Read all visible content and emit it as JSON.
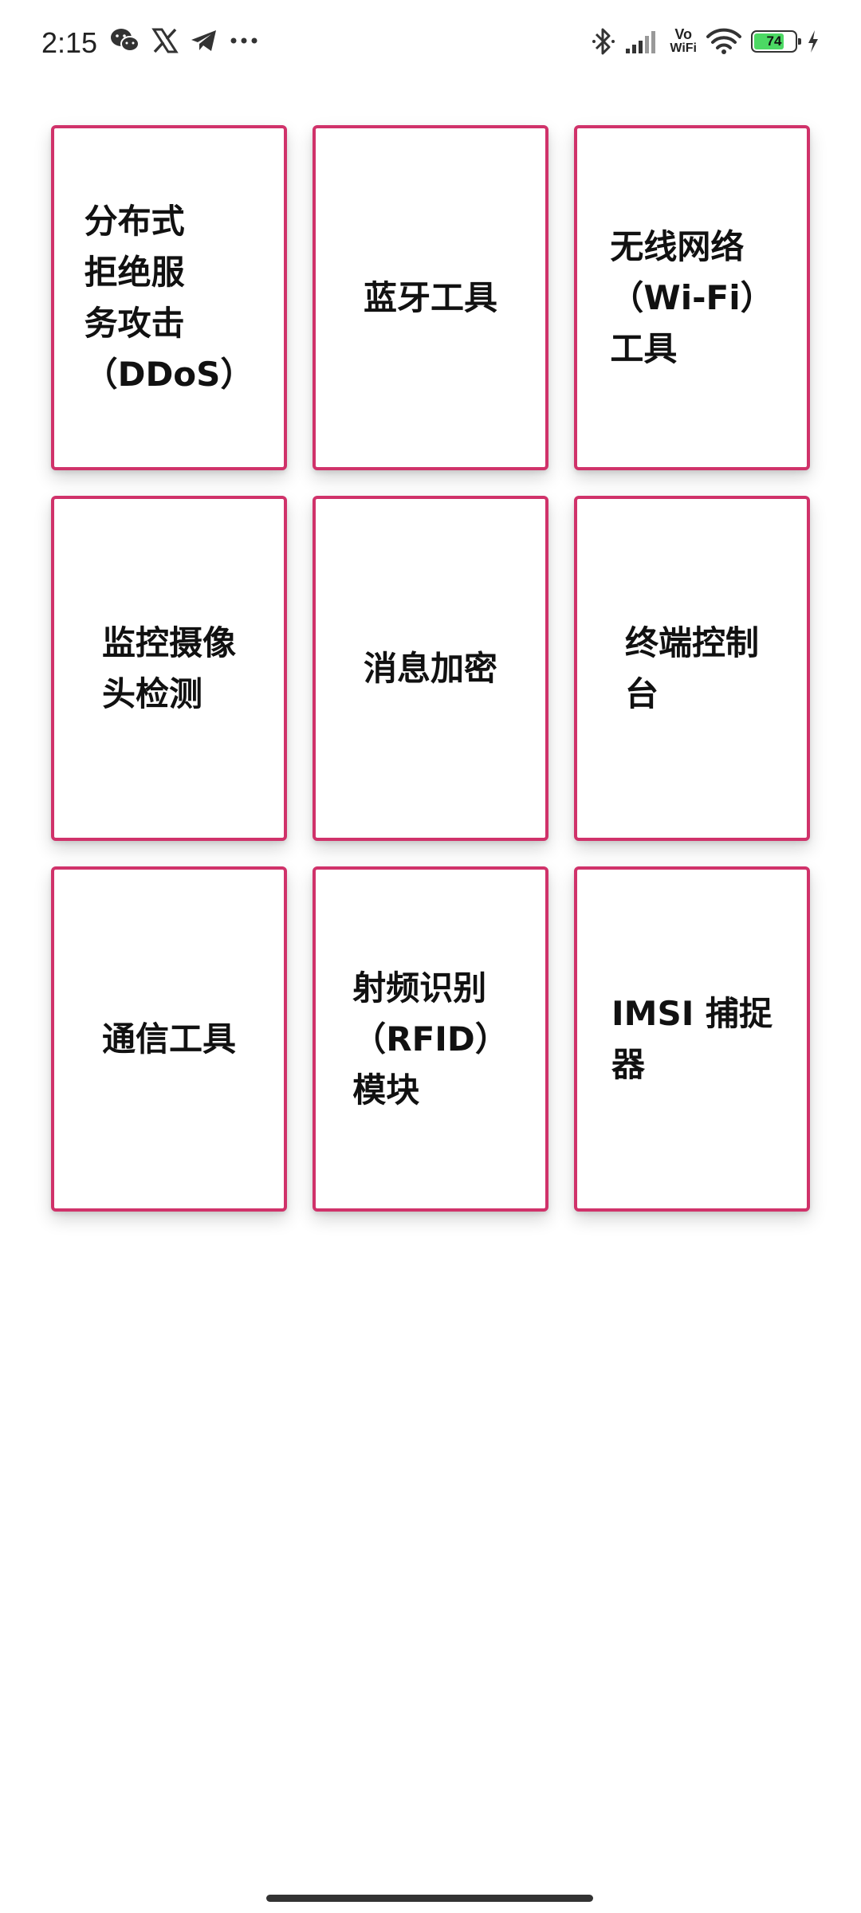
{
  "status_bar": {
    "time": "2:15",
    "left_icons": [
      "wechat-icon",
      "x-icon",
      "telegram-icon",
      "more-dots-icon"
    ],
    "right_icons": [
      "bluetooth-icon",
      "signal-icon",
      "vowifi-icon",
      "wifi-icon",
      "battery-icon",
      "charging-icon"
    ],
    "vowifi_top": "Vo",
    "vowifi_bottom": "WiFi",
    "battery_level": "74",
    "battery_fill_fraction": 0.74,
    "battery_color": "#4cd964"
  },
  "tools": [
    {
      "label": "分布式\n拒绝服\n务攻击\n（DDoS）",
      "icon": "none"
    },
    {
      "label": "蓝牙工具",
      "icon": "none"
    },
    {
      "label": "无线网络\n（Wi-Fi）\n工具",
      "icon": "none"
    },
    {
      "label": "监控摄像\n头检测",
      "icon": "none"
    },
    {
      "label": "消息加密",
      "icon": "none"
    },
    {
      "label": "终端控制\n台",
      "icon": "none"
    },
    {
      "label": "通信工具",
      "icon": "none"
    },
    {
      "label": "射频识别\n（RFID）\n模块",
      "icon": "none"
    },
    {
      "label": "IMSI 捕捉\n器",
      "icon": "none"
    }
  ],
  "theme": {
    "card_border_color": "#d0326a",
    "background": "#ffffff"
  }
}
